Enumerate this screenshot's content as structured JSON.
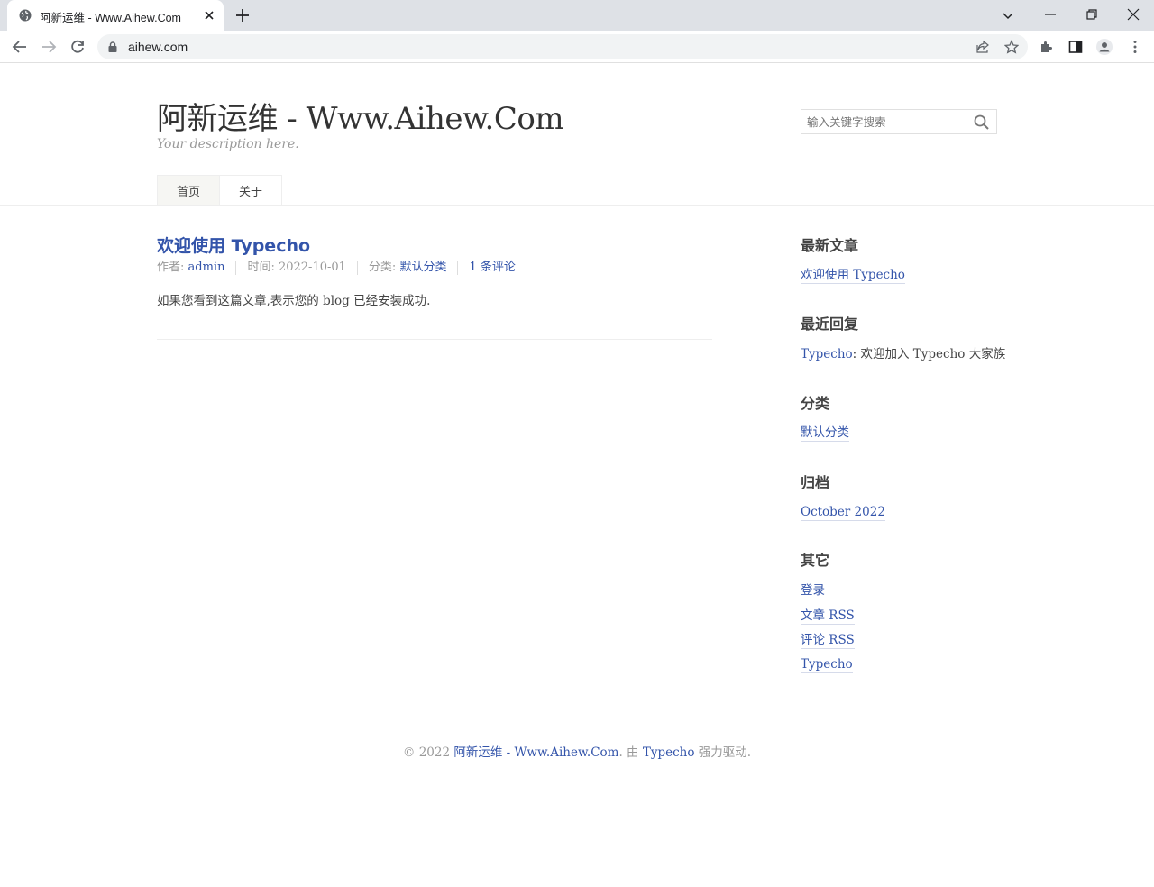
{
  "browser": {
    "tab_title": "阿新运维 - Www.Aihew.Com",
    "url": "aihew.com"
  },
  "site": {
    "title": "阿新运维 - Www.Aihew.Com",
    "description": "Your description here."
  },
  "search": {
    "placeholder": "输入关键字搜索"
  },
  "nav": {
    "items": [
      {
        "label": "首页",
        "current": true
      },
      {
        "label": "关于",
        "current": false
      }
    ]
  },
  "post": {
    "title": "欢迎使用 Typecho",
    "author_label": "作者: ",
    "author": "admin",
    "time_label": "时间: ",
    "time": "2022-10-01",
    "category_label": "分类: ",
    "category": "默认分类",
    "comments": "1 条评论",
    "body": "如果您看到这篇文章,表示您的 blog 已经安装成功."
  },
  "sidebar": {
    "recent_posts_title": "最新文章",
    "recent_posts": [
      "欢迎使用 Typecho"
    ],
    "recent_comments_title": "最近回复",
    "recent_comment_author": "Typecho",
    "recent_comment_text": ": 欢迎加入 Typecho 大家族",
    "categories_title": "分类",
    "categories": [
      "默认分类"
    ],
    "archives_title": "归档",
    "archives": [
      "October 2022"
    ],
    "misc_title": "其它",
    "misc": [
      "登录",
      "文章 RSS",
      "评论 RSS",
      "Typecho"
    ]
  },
  "footer": {
    "prefix": "© 2022 ",
    "site_link": "阿新运维 - Www.Aihew.Com",
    "middle": ". 由 ",
    "engine_link": "Typecho",
    "suffix": " 强力驱动."
  },
  "colors": {
    "link": "#3354aa",
    "text": "#444444",
    "muted": "#999999"
  }
}
